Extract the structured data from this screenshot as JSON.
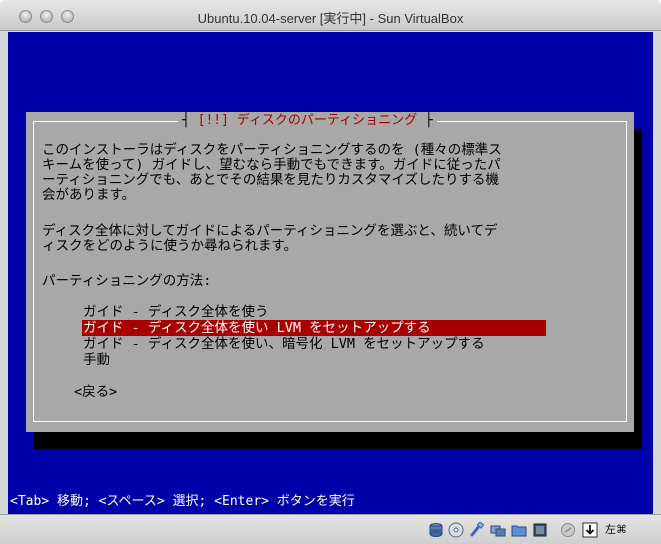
{
  "window": {
    "title": "Ubuntu.10.04-server [実行中] - Sun VirtualBox"
  },
  "dialog": {
    "title_prefix": "┤ ",
    "title": "[!!] ディスクのパーティショニング",
    "title_suffix": " ├",
    "intro_lines": [
      "このインストーラはディスクをパーティショニングするのを (種々の標準ス",
      "キームを使って) ガイドし、望むなら手動でもできます。ガイドに従ったパ",
      "ーティショニングでも、あとでその結果を見たりカスタマイズしたりする機",
      "会があります。"
    ],
    "intro2_lines": [
      "ディスク全体に対してガイドによるパーティショニングを選ぶと、続いてデ",
      "ィスクをどのように使うか尋ねられます。"
    ],
    "method_label": "パーティショニングの方法:",
    "options": [
      "ガイド - ディスク全体を使う",
      "ガイド - ディスク全体を使い LVM をセットアップする",
      "ガイド - ディスク全体を使い、暗号化 LVM をセットアップする",
      "手動"
    ],
    "selected_index": 1,
    "back_label": "<戻る>"
  },
  "hint_bar": "<Tab> 移動; <スペース> 選択; <Enter> ボタンを実行",
  "statusbar": {
    "icons": [
      "hard-disk-icon",
      "optical-disc-icon",
      "usb-icon",
      "network-icon",
      "shared-folder-icon",
      "capture-icon",
      "mouse-integration-icon",
      "hostkey-arrow-icon"
    ],
    "host_key_label": "左⌘"
  },
  "colors": {
    "screen_bg": "#0000a8",
    "dialog_bg": "#a8a8a8",
    "selected_bg": "#a80000",
    "title_fg": "#a80000"
  }
}
